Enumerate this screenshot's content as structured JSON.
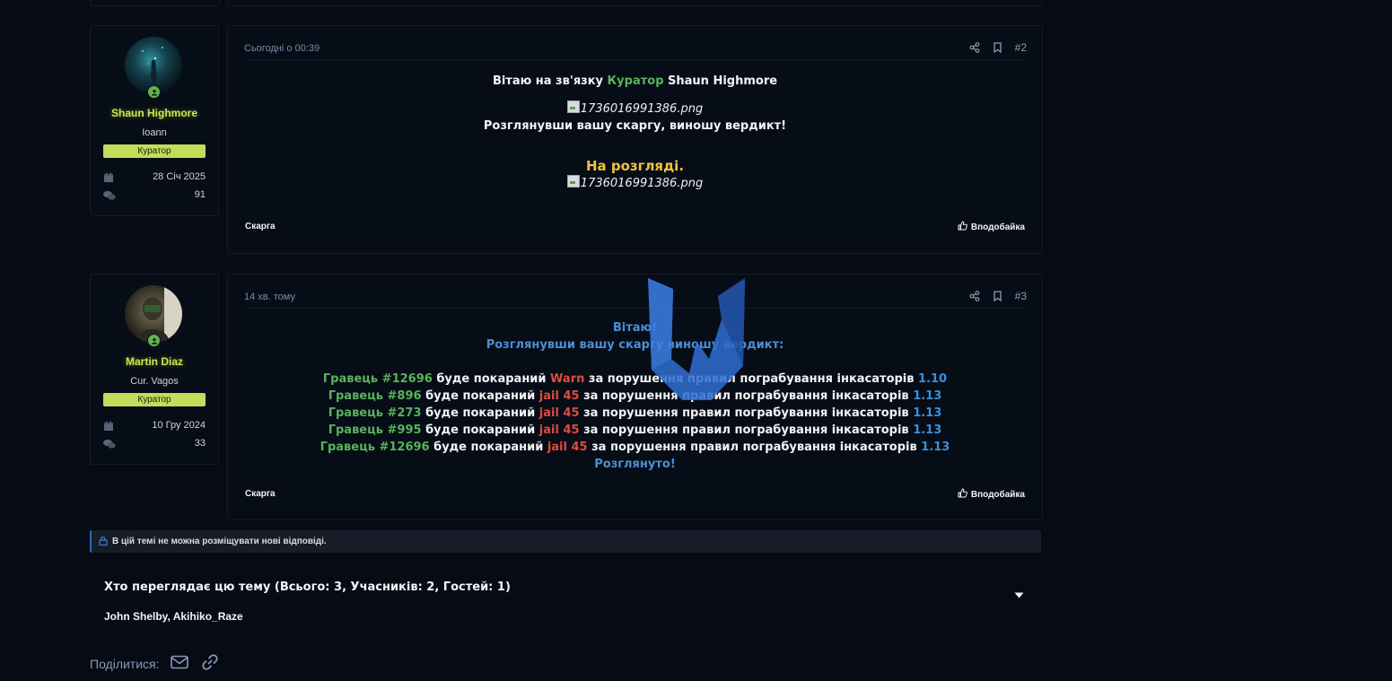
{
  "posts": [
    {
      "number": "#2",
      "date": "Сьогодні о 00:39",
      "author": {
        "name": "Shaun Highmore",
        "title": "Ioann",
        "badge": "Куратор",
        "joined": "28 Січ 2025",
        "messages": "91"
      },
      "body": {
        "greeting_prefix": "Вітаю на зв'язку ",
        "greeting_role": "Куратор",
        "greeting_name": " Shaun Highmore",
        "image_alt": "1736016991386.png",
        "verdict_line": "Розглянувши вашу скаргу, виношу вердикт!",
        "status": "На розгляді."
      },
      "footer_left": "Скарга",
      "footer_right": "Вподобайка"
    },
    {
      "number": "#3",
      "date": "14 хв. тому",
      "author": {
        "name": "Martin Diaz",
        "title": "Cur. Vagos",
        "badge": "Куратор",
        "joined": "10 Гру 2024",
        "messages": "33"
      },
      "body": {
        "line1": "Вітаю!",
        "line2": "Розглянувши вашу скаргу виношу вердикт:",
        "punishments": [
          {
            "player": "Гравець #12696",
            "mid": " буде покараний ",
            "penalty": "Warn",
            "reason": " за порушення правил пограбування інкасаторів ",
            "rule": "1.10"
          },
          {
            "player": "Гравець #896",
            "mid": " буде покараний ",
            "penalty": "jail 45",
            "reason": " за порушення правил пограбування інкасаторів ",
            "rule": "1.13"
          },
          {
            "player": "Гравець #273",
            "mid": " буде покараний ",
            "penalty": "jail 45",
            "reason": " за порушення правил пограбування інкасаторів ",
            "rule": "1.13"
          },
          {
            "player": "Гравець #995",
            "mid": " буде покараний ",
            "penalty": "jail 45",
            "reason": " за порушення правил пограбування інкасаторів ",
            "rule": "1.13"
          },
          {
            "player": "Гравець #12696",
            "mid": " буде покараний ",
            "penalty": "jail 45",
            "reason": " за порушення правил пограбування інкасаторів ",
            "rule": "1.13"
          }
        ],
        "closing": "Розглянуто!"
      },
      "footer_left": "Скарга",
      "footer_right": "Вподобайка"
    }
  ],
  "locked_notice": "В цій темі не можна розміщувати нові відповіді.",
  "viewers": {
    "title": "Хто переглядає цю тему (Всього: 3, Учасників: 2, Гостей: 1)",
    "names": [
      "John Shelby",
      "Akihiko_Raze"
    ],
    "separator": ", "
  },
  "share": {
    "label": "Поділитися:",
    "icons": [
      "email-icon",
      "link-icon"
    ]
  },
  "colors": {
    "background": "#060b14",
    "username": "#c9e94c",
    "badge": "#c4dc5a",
    "green": "#58b35a",
    "red": "#e04a3b",
    "blue": "#3d8fd8",
    "yellow": "#f0c341",
    "watermark": "#2f6ed1"
  }
}
